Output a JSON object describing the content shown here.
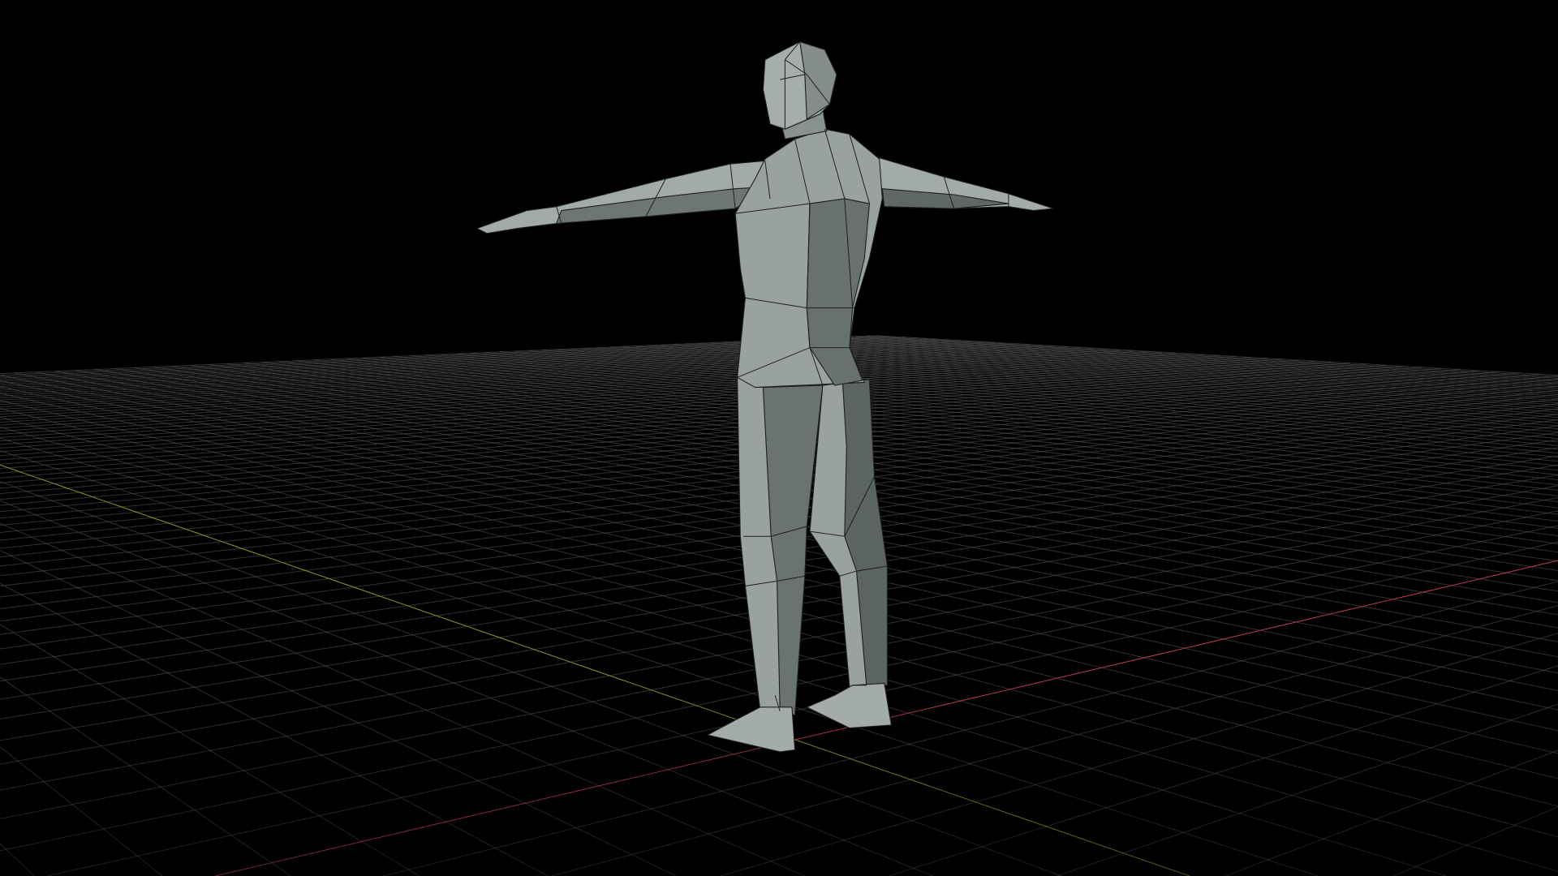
{
  "viewport": {
    "background": "#000000",
    "grid_color": "#5a5a5a",
    "x_axis_color": "#c0404e",
    "y_axis_color": "#8a9a2a",
    "mesh_light": "#9ca3a3",
    "mesh_mid": "#7d8585",
    "mesh_dark": "#5a6262",
    "object": "low-poly-humanoid-t-pose"
  }
}
